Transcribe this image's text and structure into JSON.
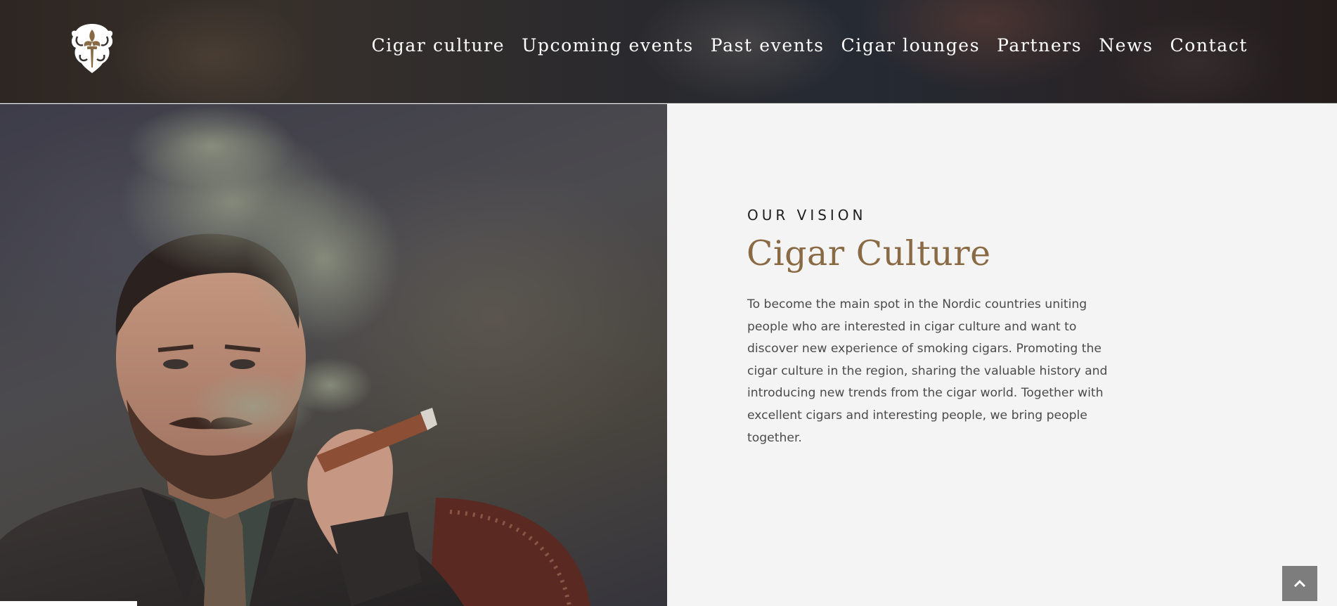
{
  "header": {
    "logo_icon": "fleur-de-lis-crest-icon",
    "nav": [
      {
        "label": "Cigar culture"
      },
      {
        "label": "Upcoming events"
      },
      {
        "label": "Past events"
      },
      {
        "label": "Cigar lounges"
      },
      {
        "label": "Partners"
      },
      {
        "label": "News"
      },
      {
        "label": "Contact"
      }
    ]
  },
  "hero": {
    "image": "portrait-man-smoking-cigar"
  },
  "vision": {
    "eyebrow": "OUR VISION",
    "title": "Cigar Culture",
    "body": "To become the main spot in the Nordic countries uniting people who are interested in cigar culture and want to discover new experience of smoking cigars. Promoting the cigar culture in the region, sharing the valuable history and introducing new trends from the cigar world. Together with excellent cigars and interesting people, we bring people together."
  },
  "back_to_top": {
    "icon": "chevron-up-icon"
  },
  "colors": {
    "accent": "#8a6a44",
    "body_text": "#4b4b4b",
    "content_bg": "#f4f4f4",
    "button_bg": "#7d7d7d"
  }
}
